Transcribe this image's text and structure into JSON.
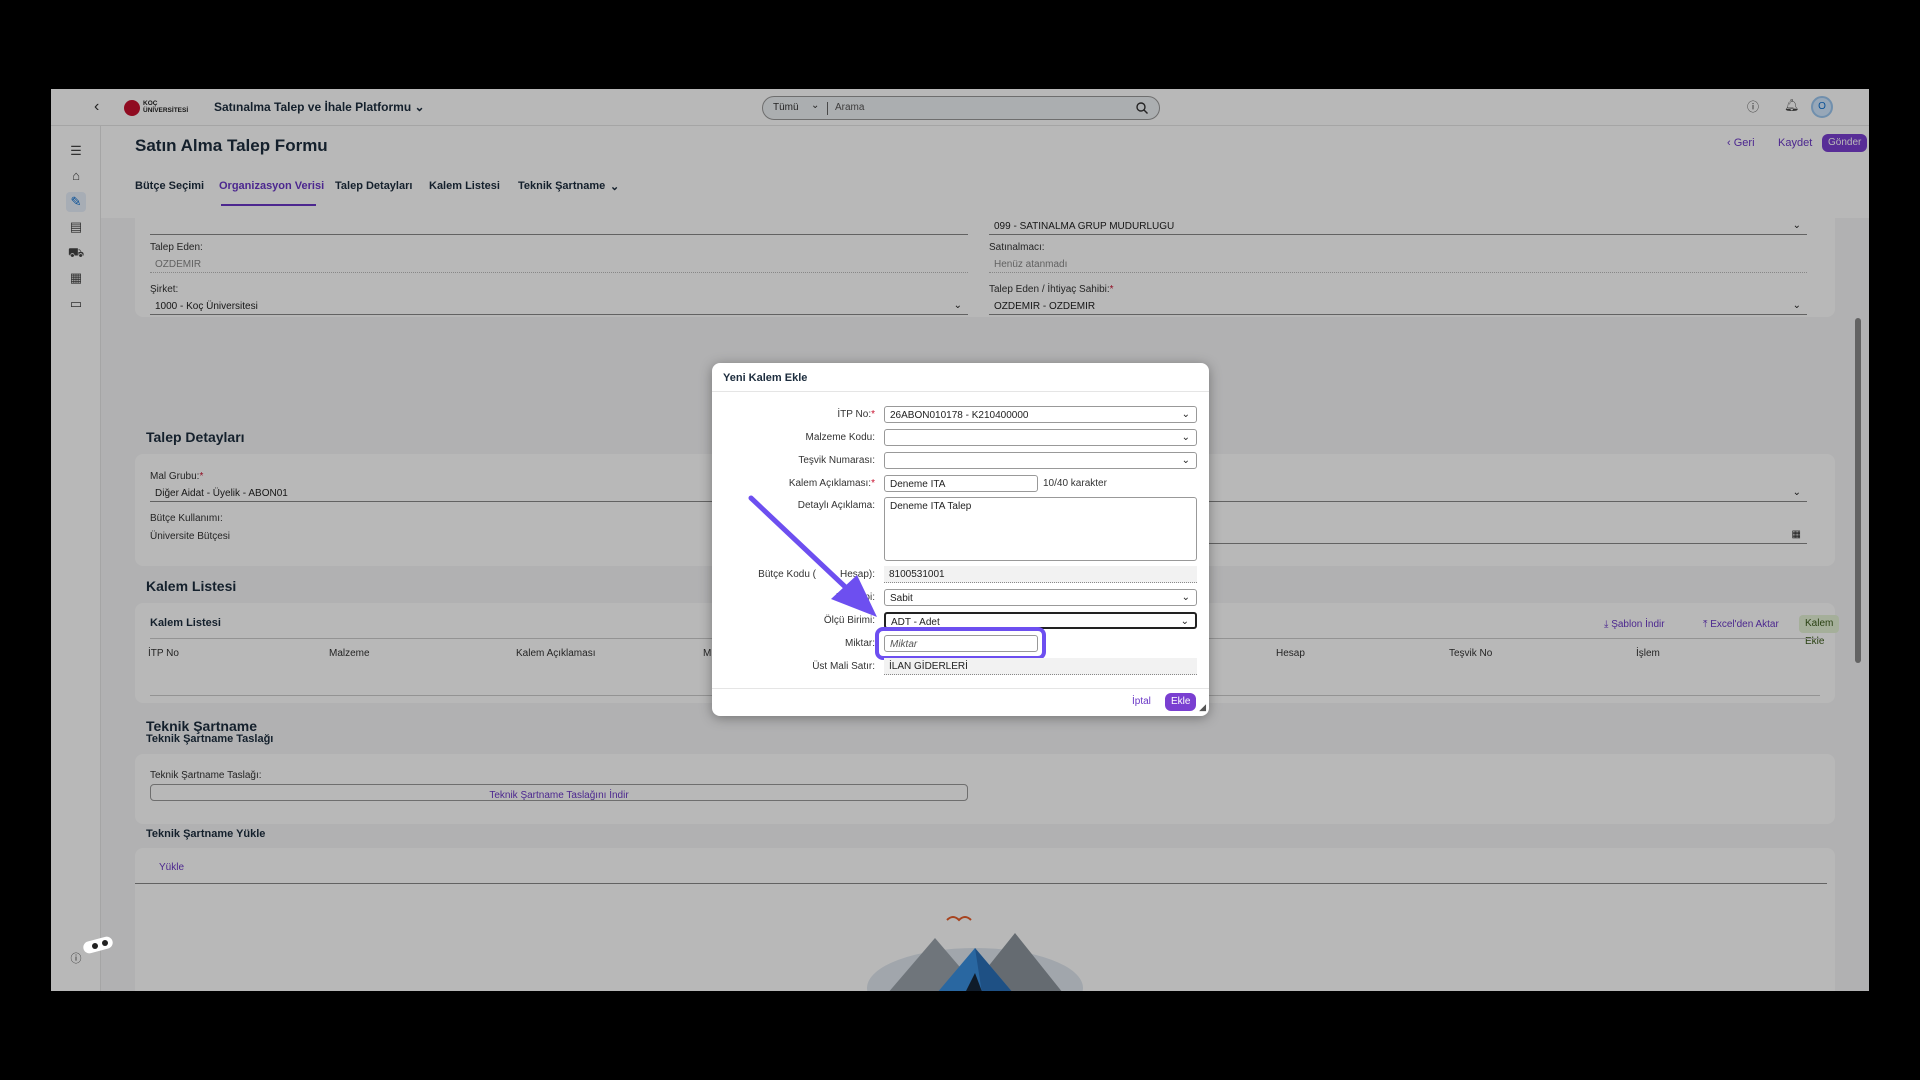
{
  "shell": {
    "logo_line1": "KOÇ",
    "logo_line2": "ÜNİVERSİTESİ",
    "app_title": "Satınalma Talep ve İhale Platformu",
    "search_scope": "Tümü",
    "search_placeholder": "Arama",
    "avatar": "O"
  },
  "header": {
    "title": "Satın Alma Talep Formu",
    "back": "Geri",
    "save": "Kaydet",
    "send": "Gönder"
  },
  "tabs": [
    "Bütçe Seçimi",
    "Organizasyon Verisi",
    "Talep Detayları",
    "Kalem Listesi",
    "Teknik Şartname"
  ],
  "org": {
    "top_right_value": "099 - SATINALMA GRUP MUDURLUGU",
    "talep_eden_label": "Talep Eden:",
    "talep_eden_value": "OZDEMIR",
    "satinalmaci_label": "Satınalmacı:",
    "satinalmaci_value": "Henüz atanmadı",
    "sirket_label": "Şirket:",
    "sirket_value": "1000 - Koç Üniversitesi",
    "ihtiyac_label": "Talep Eden / İhtiyaç Sahibi:",
    "ihtiyac_value": "OZDEMIR - OZDEMIR"
  },
  "talep_detaylari": {
    "title": "Talep Detayları",
    "mal_grubu_label": "Mal Grubu:",
    "mal_grubu_value": "Diğer Aidat - Üyelik - ABON01",
    "butce_kullanimi_label": "Bütçe Kullanımı:",
    "butce_kullanimi_value": "Üniversite Bütçesi"
  },
  "kalem_listesi": {
    "title": "Kalem Listesi",
    "card_title": "Kalem Listesi",
    "sablon": "Şablon İndir",
    "excel": "Excel'den Aktar",
    "add": "Kalem Ekle",
    "columns": [
      "İTP No",
      "Malzeme",
      "Kalem Açıklaması",
      "Mi",
      "Hesap",
      "Teşvik No",
      "İşlem"
    ]
  },
  "teknik": {
    "title": "Teknik Şartname",
    "subtitle": "Teknik Şartname Taslağı",
    "taslak_label": "Teknik Şartname Taslağı:",
    "taslak_link": "Teknik Şartname Taslağını İndir",
    "yukle_title": "Teknik Şartname Yükle",
    "yukle_link": "Yükle"
  },
  "dialog": {
    "title": "Yeni Kalem Ekle",
    "itp_label": "İTP No:",
    "itp_value": "26ABON010178 - K210400000",
    "malzeme_label": "Malzeme Kodu:",
    "tesvik_label": "Teşvik Numarası:",
    "kalem_label": "Kalem Açıklaması:",
    "kalem_value": "Deneme ITA",
    "kalem_counter": "10/40 karakter",
    "detay_label": "Detaylı Açıklama:",
    "detay_value": "Deneme ITA Talep",
    "butce_kodu_label": "Bütçe Kodu (",
    "butce_kodu_label_end": "Hesap):",
    "butce_kodu_value": "8100531001",
    "tip_label_start": "M",
    "tip_label_end": "ipi:",
    "tip_value": "Sabit",
    "olcu_label": "Ölçü Birimi:",
    "olcu_value": "ADT - Adet",
    "miktar_label": "Miktar:",
    "miktar_placeholder": "Miktar",
    "ust_mali_label": "Üst Mali Satır:",
    "ust_mali_value": "İLAN GİDERLERİ",
    "cancel": "İptal",
    "add": "Ekle"
  },
  "colors": {
    "accent": "#6a37c6",
    "highlight": "#6d4ff0"
  }
}
